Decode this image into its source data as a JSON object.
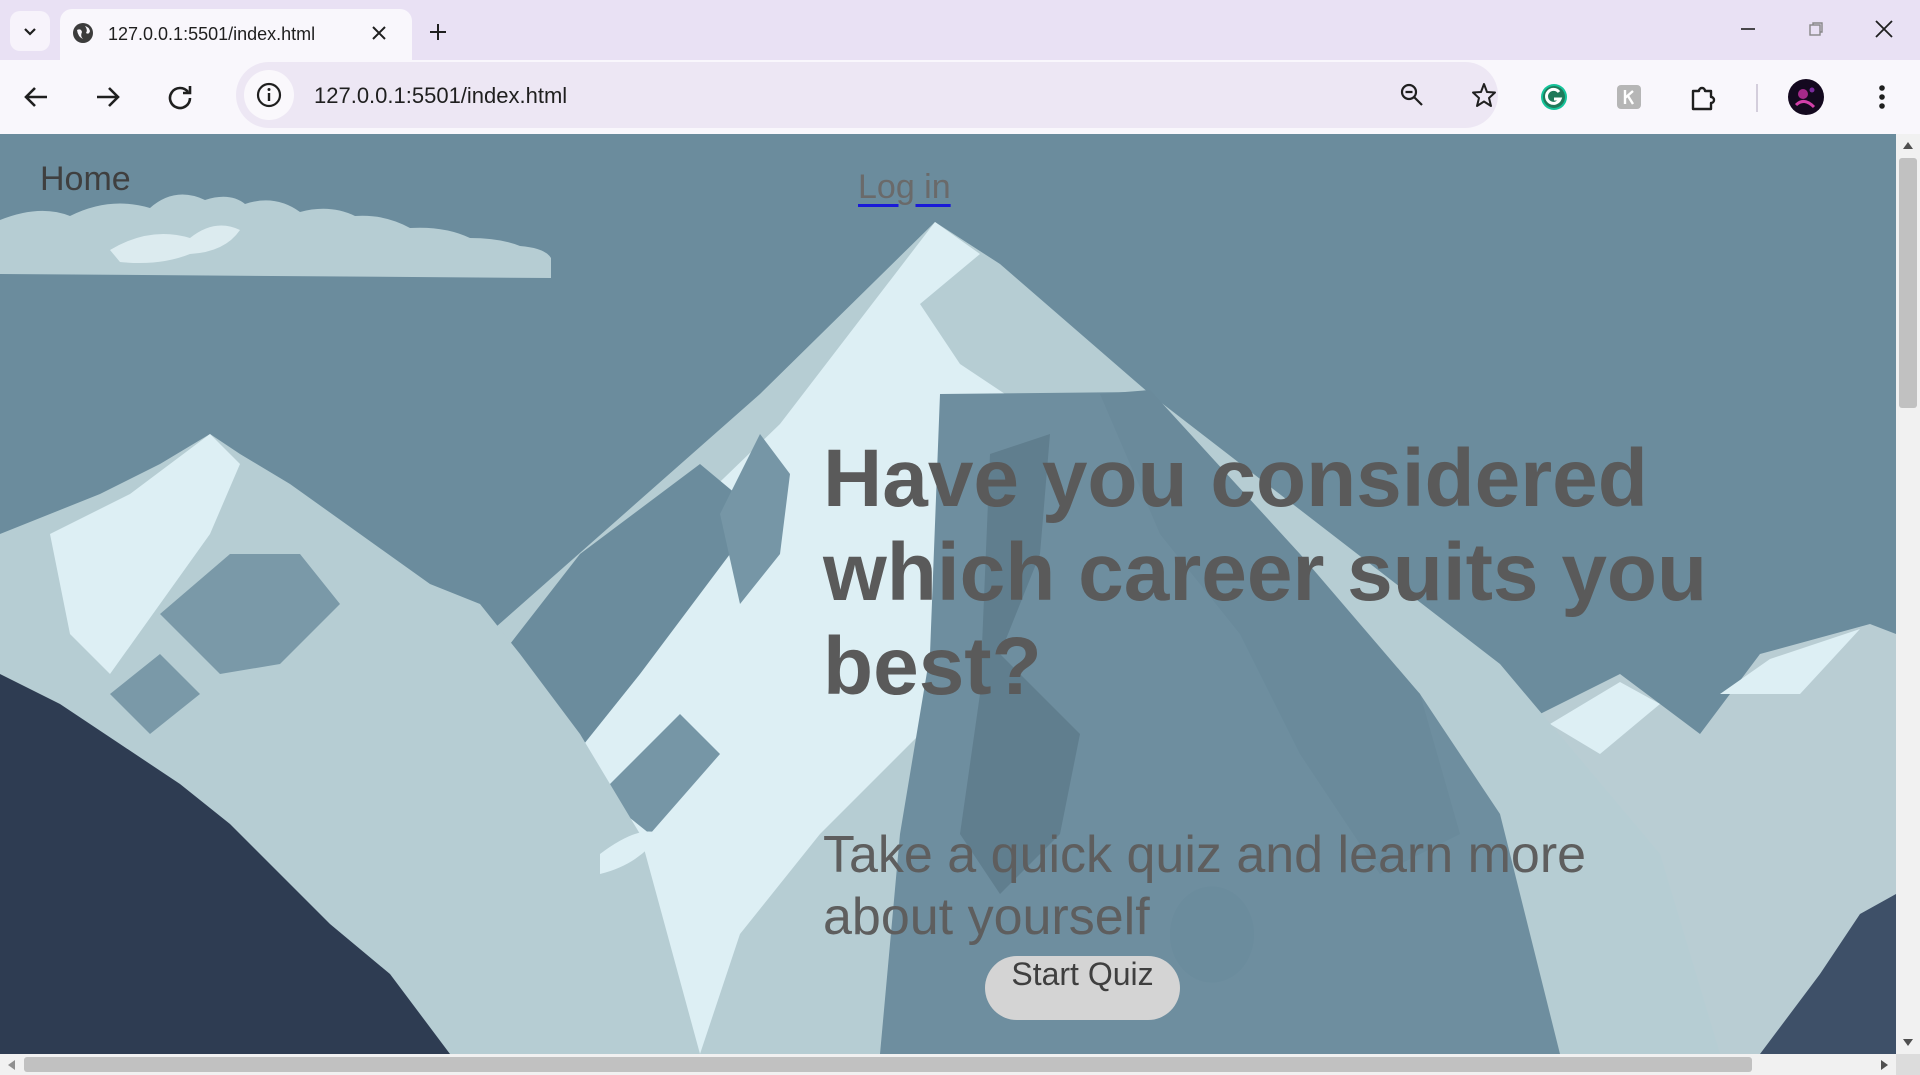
{
  "browser": {
    "tab": {
      "title": "127.0.0.1:5501/index.html",
      "favicon": "globe-icon"
    },
    "new_tab_icon": "plus-icon",
    "window_controls": [
      "minimize-icon",
      "restore-icon",
      "close-icon"
    ],
    "nav": [
      "back-arrow-icon",
      "forward-arrow-icon",
      "reload-icon"
    ],
    "address": {
      "url": "127.0.0.1:5501/index.html",
      "site_info_icon": "info-icon"
    },
    "omnibox_icons": [
      "zoom-out-icon",
      "star-bookmark-icon"
    ],
    "extensions": [
      "grammarly-icon",
      "extension-k-icon",
      "puzzle-extensions-icon",
      "profile-avatar",
      "kebab-menu-icon"
    ]
  },
  "page": {
    "nav": {
      "home": "Home",
      "login": "Log in"
    },
    "hero": {
      "headline": "Have you considered which career suits you best?",
      "subheadline": "Take a quick quiz and learn more about yourself",
      "cta": "Start Quiz"
    },
    "background": "mountain-illustration",
    "colors": {
      "sky": "#6b8c9d",
      "snow": "#ddeff4",
      "text": "#5a5a5a",
      "button": "#d4d4d4"
    }
  }
}
